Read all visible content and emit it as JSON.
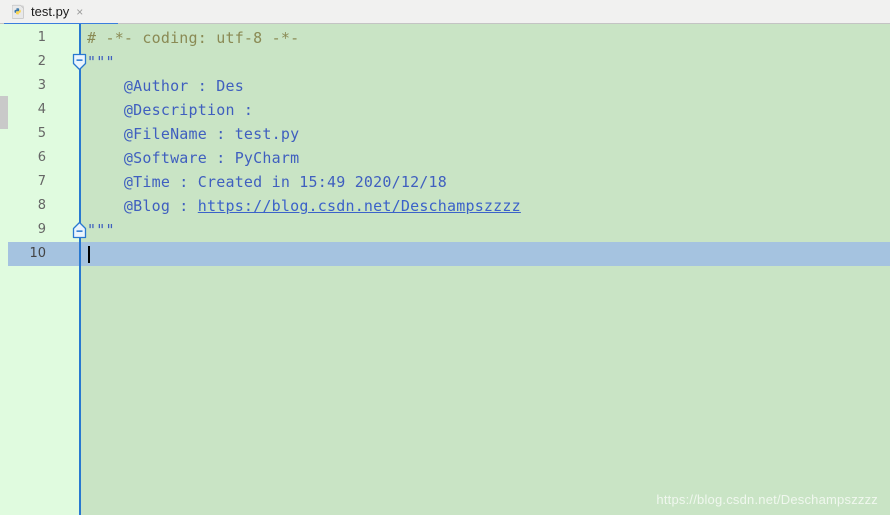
{
  "window": {
    "app": "PyCharm Editor",
    "background_color": "#c9e4c5",
    "gutter_color": "#e0fbdf",
    "current_line_color": "#a5c3e0",
    "accent_color": "#2878d0"
  },
  "tab_bar": {
    "tabs": [
      {
        "label": "test.py",
        "icon": "python-file-icon",
        "close_label": "×",
        "active": true
      }
    ]
  },
  "editor": {
    "caret_line": 10,
    "caret_column": 1,
    "lines": [
      {
        "number": "1",
        "indent": 0,
        "segments": [
          {
            "text": "# -*- coding: utf-8 -*-",
            "style": "comment"
          }
        ]
      },
      {
        "number": "2",
        "indent": 0,
        "fold": "collapse-start",
        "segments": [
          {
            "text": "\"\"\"",
            "style": "doc"
          }
        ]
      },
      {
        "number": "3",
        "indent": 0,
        "segments": [
          {
            "text": "    @Author : Des",
            "style": "doc"
          }
        ]
      },
      {
        "number": "4",
        "indent": 0,
        "segments": [
          {
            "text": "    @Description :",
            "style": "doc"
          }
        ]
      },
      {
        "number": "5",
        "indent": 0,
        "segments": [
          {
            "text": "    @FileName : test.py",
            "style": "doc"
          }
        ]
      },
      {
        "number": "6",
        "indent": 0,
        "segments": [
          {
            "text": "    @Software : PyCharm",
            "style": "doc"
          }
        ]
      },
      {
        "number": "7",
        "indent": 0,
        "segments": [
          {
            "text": "    @Time : Created in 15:49 2020/12/18",
            "style": "doc"
          }
        ]
      },
      {
        "number": "8",
        "indent": 0,
        "segments": [
          {
            "text": "    @Blog : ",
            "style": "doc"
          },
          {
            "text": "https://blog.csdn.net/Deschampszzzz",
            "style": "link"
          }
        ]
      },
      {
        "number": "9",
        "indent": 0,
        "fold": "collapse-end",
        "segments": [
          {
            "text": "\"\"\"",
            "style": "doc"
          }
        ]
      },
      {
        "number": "10",
        "indent": 0,
        "current": true,
        "segments": []
      }
    ]
  },
  "watermark": {
    "text": "https://blog.csdn.net/Deschampszzzz"
  }
}
